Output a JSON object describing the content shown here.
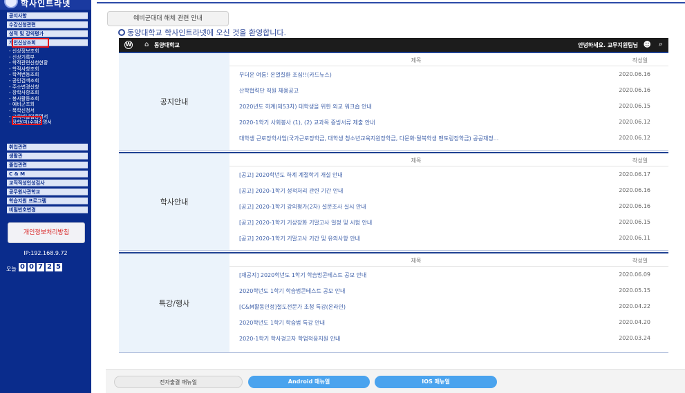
{
  "sidebar": {
    "logo_text": "학사인트라넷",
    "menu_top": [
      "공지사항",
      "수강신청관련",
      "성적 및 강의평가",
      "개인신상조회"
    ],
    "sub_items": [
      "- 신상정보조회",
      "- 신상기록부",
      "- 학적관련신청현황",
      "- 학적사항조회",
      "- 학적변동조회",
      "- 공인검색조회",
      "- 주소변경신청",
      "- 장학사항조회",
      "- 봉사활동조회",
      "- 예비군조회",
      "- 복학신청서",
      "- 교육비납입증명서",
      "- 장학(미)수혜증명서"
    ],
    "menu_bottom": [
      "취업관련",
      "생활관",
      "졸업관련",
      "C & M",
      "교직적성인성검사",
      "공무원사관학교",
      "학습지원 프로그램",
      "비밀번호변경"
    ],
    "privacy_label": "개인정보처리방침",
    "ip": "IP:192.168.9.72",
    "visit_label": "오늘",
    "visit_digits": [
      "0",
      "0",
      "7",
      "2",
      "5"
    ]
  },
  "main": {
    "notice_button": "예비군대대 해체 관련 안내",
    "welcome": "동양대학교 학사인트라넷에 오신 것을 환영합니다.",
    "bar": {
      "site_name": "동양대학교",
      "greeting": "안녕하세요. 교무지원팀님"
    },
    "header_title": "제목",
    "header_date": "작성일",
    "sections": [
      {
        "label": "공지안내",
        "rows": [
          {
            "title": "무더운 여름! 온열질환 조심!!(카드뉴스)",
            "date": "2020.06.16"
          },
          {
            "title": "산학협력단 직원 채용공고",
            "date": "2020.06.16"
          },
          {
            "title": "2020년도 하계(제53차) 대학생을 위한 외교 워크숍 안내",
            "date": "2020.06.15"
          },
          {
            "title": "2020-1학기 사회봉사 (1), (2) 교과목 증빙서류 제출 안내",
            "date": "2020.06.12"
          },
          {
            "title": "대학생 근로장학사업(국가근로장학금, 대학생 청소년교육지원장학금, 다문화·탈북학생 멘토링장학금) 공공재정...",
            "date": "2020.06.12"
          }
        ]
      },
      {
        "label": "학사안내",
        "rows": [
          {
            "title": "[공고] 2020학년도 하계 계절학기 개설 안내",
            "date": "2020.06.17"
          },
          {
            "title": "[공고] 2020-1학기 성적처리 관련 기간 안내",
            "date": "2020.06.16"
          },
          {
            "title": "[공고] 2020-1학기 강의평가(2차) 설문조사 실시 안내",
            "date": "2020.06.16"
          },
          {
            "title": "[공고] 2020-1학기 기상장화 기말고사 일정 및 시험 안내",
            "date": "2020.06.15"
          },
          {
            "title": "[공고] 2020-1학기 기말고사 기간 및 유의사항 안내",
            "date": "2020.06.11"
          }
        ]
      },
      {
        "label": "특강/행사",
        "rows": [
          {
            "title": "[재공지] 2020학년도 1학기 학습법콘테스트 공모 안내",
            "date": "2020.06.09"
          },
          {
            "title": "2020학년도 1학기 학습법콘테스트 공모 안내",
            "date": "2020.05.15"
          },
          {
            "title": "[C&M활동인정]철도전문가 초청 특강(온라인)",
            "date": "2020.04.22"
          },
          {
            "title": "2020학년도 1학기 학습법 특강 안내",
            "date": "2020.04.20"
          },
          {
            "title": "2020-1학기 학사경고자 학업적응지원 안내",
            "date": "2020.03.24"
          }
        ]
      }
    ]
  },
  "bottom": {
    "manual": "전자출결 매뉴얼",
    "android": "Android 매뉴얼",
    "ios": "IOS 매뉴얼"
  },
  "colors": {
    "sidebar_bg": "#0a2c8c",
    "highlight": "#e3141b",
    "link": "#3d5fa8",
    "section_label_bg": "#ebf3fb",
    "app_button": "#4aa3ee"
  },
  "icons": [
    "wordpress-icon",
    "home-icon",
    "user-icon",
    "search-icon"
  ]
}
